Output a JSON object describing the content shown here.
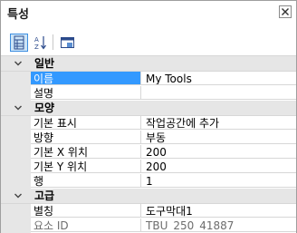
{
  "panel": {
    "title": "특성"
  },
  "toolbar": {
    "categorized_icon": "categorized-icon",
    "alphabetical_icon": "sort-az-icon",
    "property_pages_icon": "property-pages-icon"
  },
  "categories": [
    {
      "label": "일반",
      "props": [
        {
          "name": "이름",
          "value": "My Tools",
          "selected": true,
          "readonly": false
        },
        {
          "name": "설명",
          "value": "",
          "selected": false,
          "readonly": false
        }
      ]
    },
    {
      "label": "모양",
      "props": [
        {
          "name": "기본 표시",
          "value": "작업공간에 추가",
          "selected": false,
          "readonly": false
        },
        {
          "name": "방향",
          "value": "부동",
          "selected": false,
          "readonly": false
        },
        {
          "name": "기본 X 위치",
          "value": "200",
          "selected": false,
          "readonly": false
        },
        {
          "name": "기본 Y 위치",
          "value": "200",
          "selected": false,
          "readonly": false
        },
        {
          "name": "행",
          "value": "1",
          "selected": false,
          "readonly": false
        }
      ]
    },
    {
      "label": "고급",
      "props": [
        {
          "name": "별칭",
          "value": "도구막대1",
          "selected": false,
          "readonly": false
        },
        {
          "name": "요소 ID",
          "value": "TBU_250_41887",
          "selected": false,
          "readonly": true
        }
      ]
    }
  ],
  "colors": {
    "selection": "#3399ff",
    "category_bg": "#e6e6e6",
    "grid_line": "#d7d7d7"
  }
}
